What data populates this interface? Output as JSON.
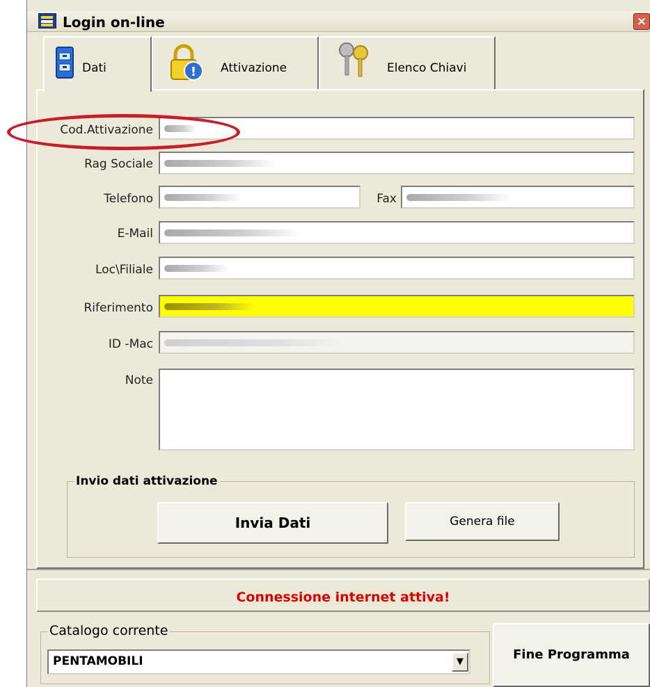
{
  "window": {
    "title": "Login on-line",
    "close_glyph": "×"
  },
  "tabs": [
    {
      "label": "Dati",
      "icon": "file-cabinet-icon"
    },
    {
      "label": "Attivazione",
      "icon": "padlock-warning-icon"
    },
    {
      "label": "Elenco Chiavi",
      "icon": "keys-icon"
    }
  ],
  "form": {
    "cod_attivazione_label": "Cod.Attivazione",
    "rag_sociale_label": "Rag Sociale",
    "telefono_label": "Telefono",
    "fax_label": "Fax",
    "email_label": "E-Mail",
    "loc_filiale_label": "Loc\\Filiale",
    "riferimento_label": "Riferimento",
    "id_mac_label": "ID -Mac",
    "note_label": "Note"
  },
  "invio": {
    "group_title": "Invio dati attivazione",
    "invia_label": "Invia Dati",
    "genera_label": "Genera file"
  },
  "status": {
    "text": "Connessione internet attiva!"
  },
  "catalogo": {
    "group_title": "Catalogo corrente",
    "selected": "PENTAMOBILI"
  },
  "fine_label": "Fine Programma",
  "colors": {
    "highlight": "#c81e2a",
    "riferimento_bg": "#ffff00",
    "status_text": "#d90000"
  }
}
